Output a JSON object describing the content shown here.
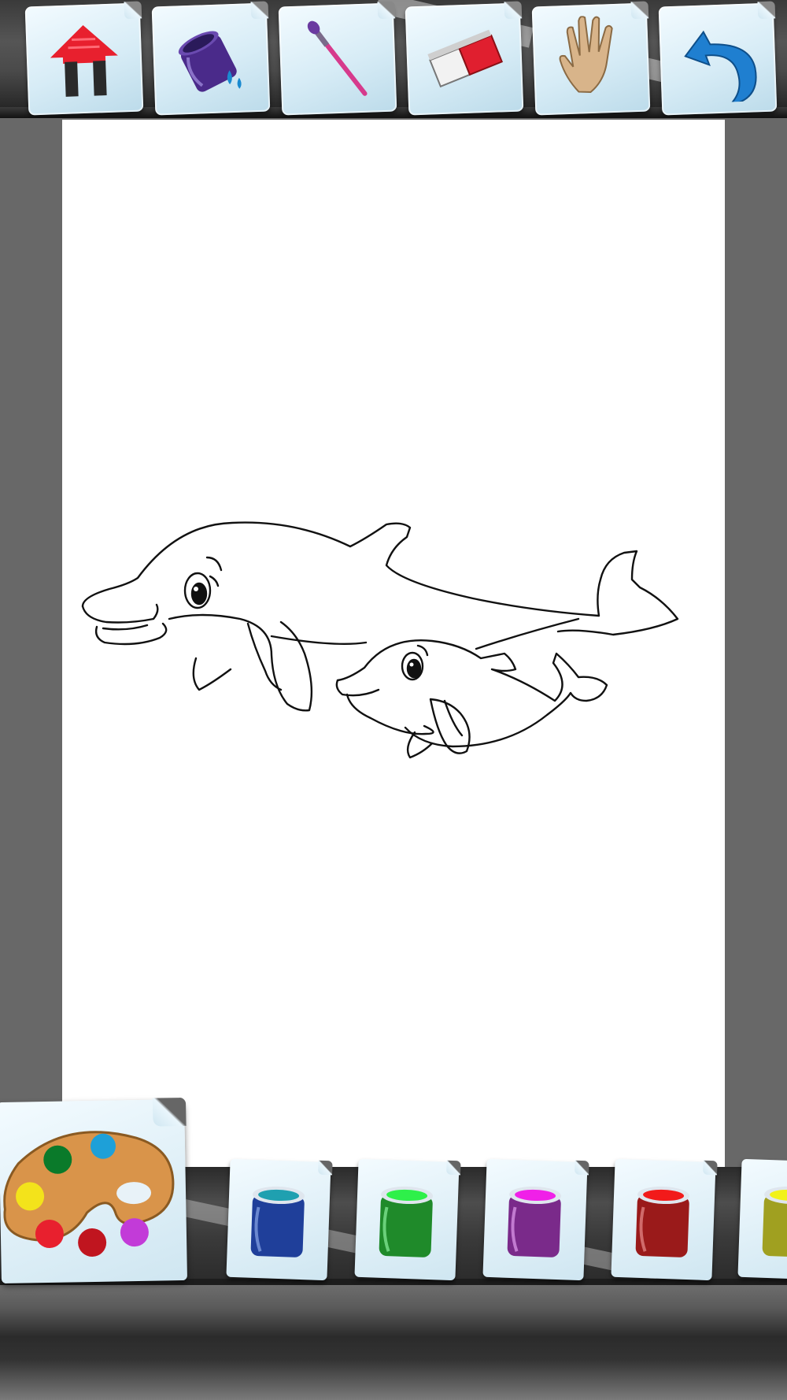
{
  "toolbar": {
    "tools": [
      {
        "id": "home",
        "icon": "home-icon",
        "color": "#e8202e"
      },
      {
        "id": "fill",
        "icon": "paint-bucket-icon",
        "color": "#4a2a8a"
      },
      {
        "id": "brush",
        "icon": "brush-icon",
        "color": "#d63a8c"
      },
      {
        "id": "eraser",
        "icon": "eraser-icon",
        "color": "#e01f2f"
      },
      {
        "id": "pan",
        "icon": "hand-icon",
        "color": "#b98a5c"
      },
      {
        "id": "undo",
        "icon": "undo-arrow-icon",
        "color": "#1f7fd0"
      }
    ]
  },
  "canvas": {
    "artwork": "dolphins-coloring-page",
    "background": "#ffffff"
  },
  "palette": {
    "icon": "palette-icon",
    "swatches": [
      "#0a7a2a",
      "#1ea0d8",
      "#f3e31b",
      "#e8202e",
      "#c0151f",
      "#c23bd8"
    ]
  },
  "paints": [
    {
      "name": "blue",
      "color": "#1f3f9a",
      "lid": "#1fa0b0"
    },
    {
      "name": "green",
      "color": "#1f8a2a",
      "lid": "#2ef04a"
    },
    {
      "name": "purple",
      "color": "#7a2a8a",
      "lid": "#f020e8"
    },
    {
      "name": "red",
      "color": "#9a1a1a",
      "lid": "#f21a1a"
    },
    {
      "name": "yellow",
      "color": "#a0a020",
      "lid": "#f2f21a"
    }
  ]
}
